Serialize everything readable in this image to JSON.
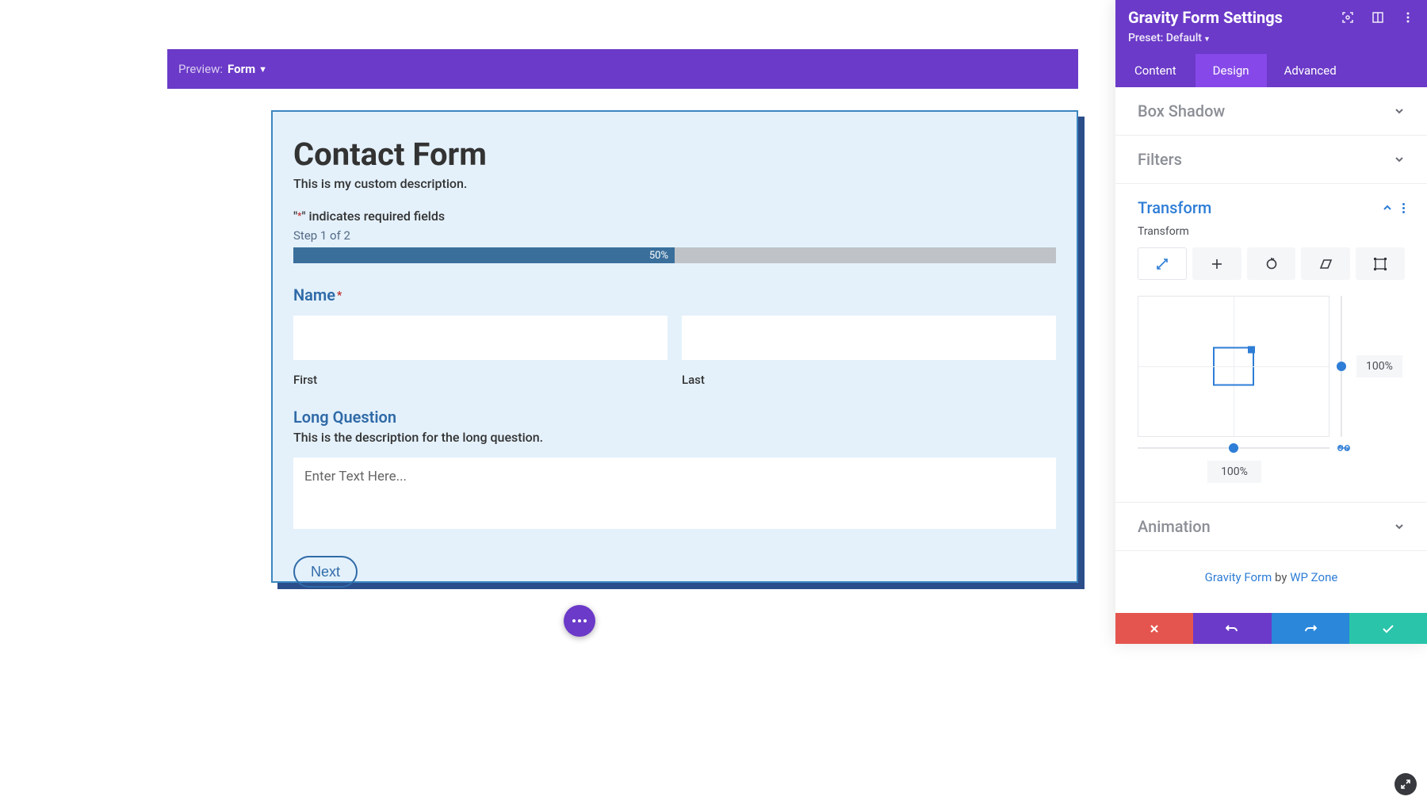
{
  "preview_bar": {
    "label": "Preview:",
    "mode": "Form"
  },
  "form": {
    "title": "Contact Form",
    "description": "This is my custom description.",
    "required_text_pre": "\"",
    "required_text_post": "\" indicates required fields",
    "step_text": "Step 1 of 2",
    "progress_pct": "50%",
    "name_label": "Name",
    "first_label": "First",
    "last_label": "Last",
    "long_q_label": "Long Question",
    "long_q_desc": "This is the description for the long question.",
    "long_q_placeholder": "Enter Text Here...",
    "next_label": "Next"
  },
  "panel": {
    "title": "Gravity Form Settings",
    "preset_label": "Preset: Default",
    "tabs": {
      "content": "Content",
      "design": "Design",
      "advanced": "Advanced"
    },
    "sections": {
      "box_shadow": "Box Shadow",
      "filters": "Filters",
      "transform": "Transform",
      "animation": "Animation"
    },
    "transform_opt_label": "Transform",
    "scale_x": "100%",
    "scale_y": "100%",
    "credit_link1": "Gravity Form",
    "credit_by": " by ",
    "credit_link2": "WP Zone"
  }
}
